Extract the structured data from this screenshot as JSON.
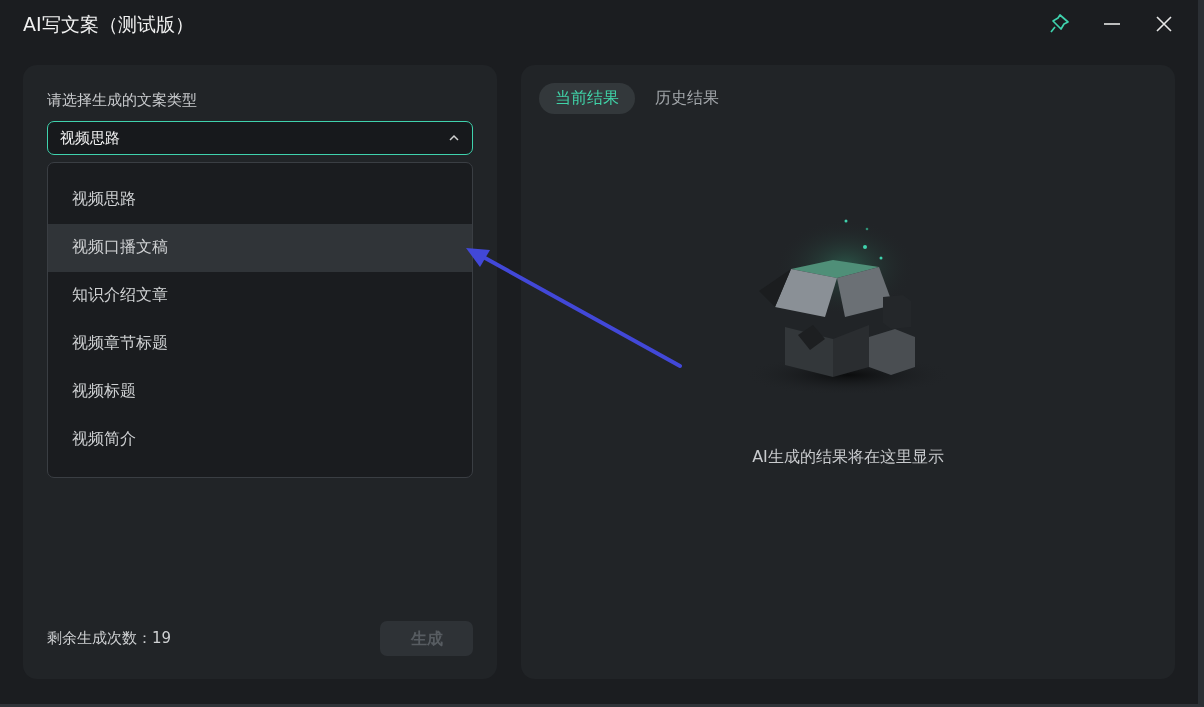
{
  "window": {
    "title": "AI写文案（测试版）",
    "pinned": true
  },
  "left_panel": {
    "label": "请选择生成的文案类型",
    "dropdown": {
      "value": "视频思路",
      "expanded": true,
      "options": [
        {
          "label": "视频思路",
          "highlighted": false
        },
        {
          "label": "视频口播文稿",
          "highlighted": true
        },
        {
          "label": "知识介绍文章",
          "highlighted": false
        },
        {
          "label": "视频章节标题",
          "highlighted": false
        },
        {
          "label": "视频标题",
          "highlighted": false
        },
        {
          "label": "视频简介",
          "highlighted": false
        }
      ]
    },
    "remaining": "剩余生成次数：19",
    "generate_button": {
      "label": "生成",
      "disabled": true
    }
  },
  "right_panel": {
    "tabs": [
      {
        "label": "当前结果",
        "selected": true
      },
      {
        "label": "历史结果",
        "selected": false
      }
    ],
    "empty_message": "AI生成的结果将在这里显示"
  }
}
